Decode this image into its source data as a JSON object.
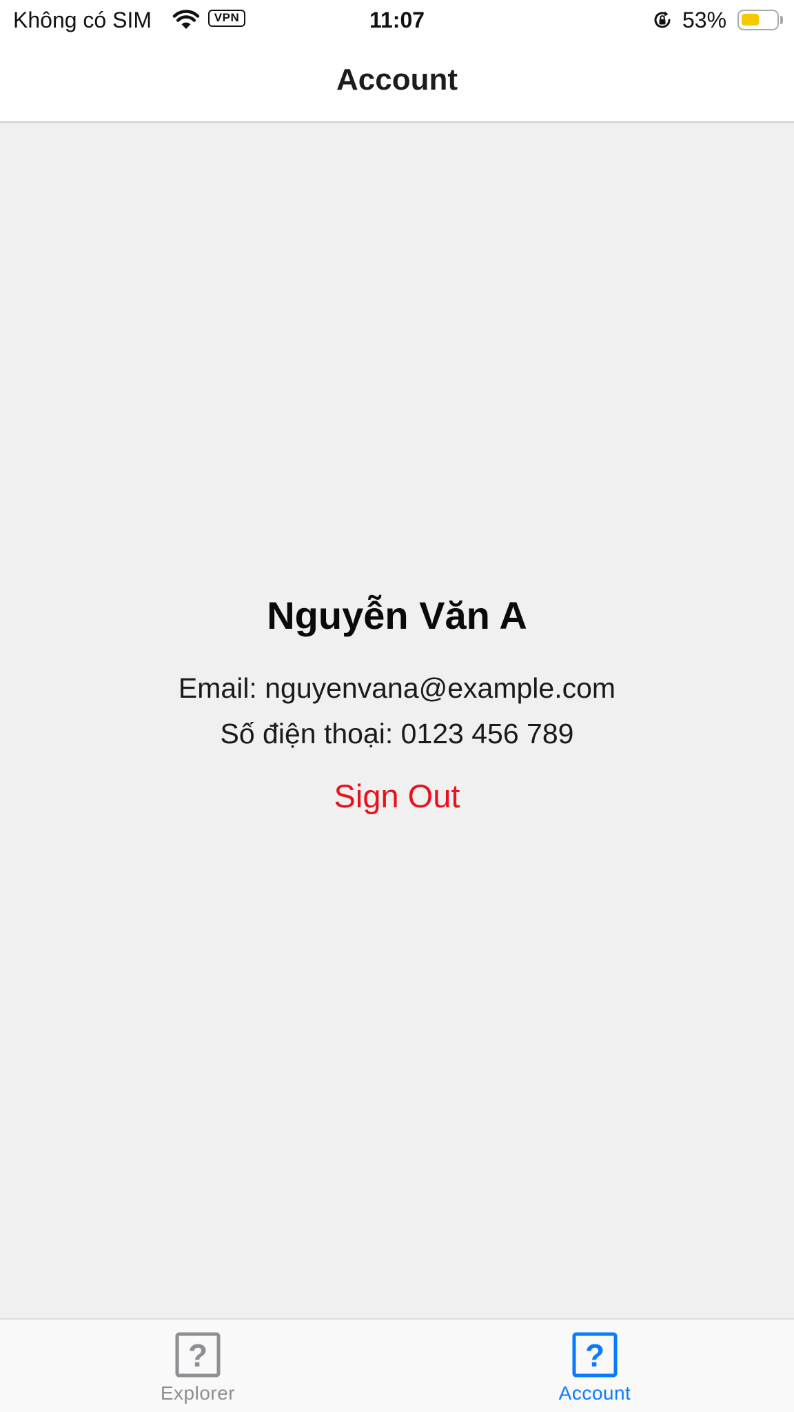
{
  "status_bar": {
    "carrier": "Không có SIM",
    "vpn": "VPN",
    "time": "11:07",
    "battery_percent_text": "53%",
    "battery_level": 0.53,
    "icons": [
      "wifi-icon",
      "vpn-badge",
      "orientation-lock-icon",
      "battery-icon"
    ]
  },
  "header": {
    "title": "Account"
  },
  "profile": {
    "name": "Nguyễn Văn A",
    "email_line": "Email: nguyenvana@example.com",
    "phone_line": "Số điện thoại: 0123 456 789",
    "sign_out_label": "Sign Out"
  },
  "tab_bar": {
    "tabs": [
      {
        "label": "Explorer",
        "icon": "question-square-icon",
        "selected": false
      },
      {
        "label": "Account",
        "icon": "question-square-icon",
        "selected": true
      }
    ]
  },
  "colors": {
    "accent": "#0a7aff",
    "inactive_tab": "#8e8e93",
    "sign_out": "#e8131a",
    "background": "#f0f0f1",
    "battery_fill": "#f6c800"
  }
}
